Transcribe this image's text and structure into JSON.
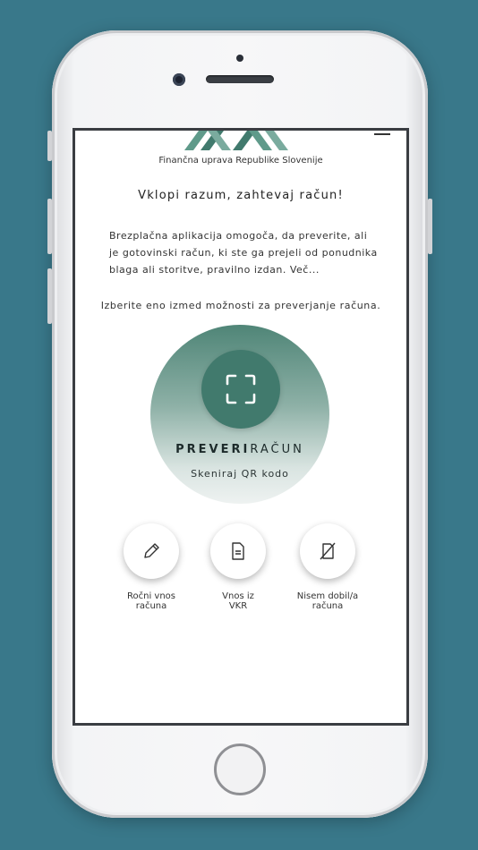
{
  "header": {
    "org_name": "Finančna uprava Republike Slovenije"
  },
  "main": {
    "headline": "Vklopi razum, zahtevaj račun!",
    "description": "Brezplačna aplikacija omogoča, da preverite, ali je gotovinski račun, ki ste ga prejeli od ponudnika blaga ali storitve, pravilno izdan. Več...",
    "choose_text": "Izberite eno izmed možnosti za preverjanje računa.",
    "check": {
      "title_bold": "PREVERI",
      "title_rest": "RAČUN",
      "subtitle": "Skeniraj QR kodo",
      "icon": "qr-scan-icon"
    },
    "options": [
      {
        "label": "Ročni vnos\nračuna",
        "icon": "pencil-icon"
      },
      {
        "label": "Vnos iz\nVKR",
        "icon": "document-icon"
      },
      {
        "label": "Nisem dobil/a\nračuna",
        "icon": "no-receipt-icon"
      }
    ]
  },
  "colors": {
    "background": "#39788a",
    "accent": "#417a6d"
  }
}
